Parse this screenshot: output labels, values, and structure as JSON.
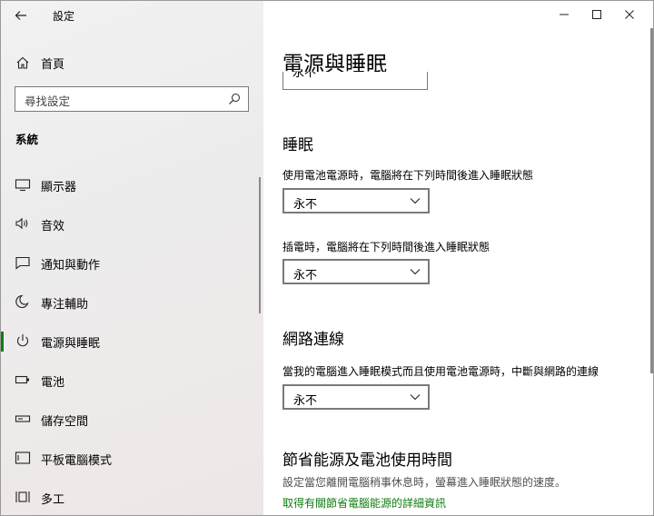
{
  "window": {
    "title": "設定",
    "minimize_icon": "minimize-icon",
    "maximize_icon": "maximize-icon",
    "close_icon": "close-icon"
  },
  "sidebar": {
    "home_label": "首頁",
    "search_placeholder": "尋找設定",
    "section_label": "系統",
    "items": [
      {
        "label": "顯示器",
        "icon": "monitor-icon"
      },
      {
        "label": "音效",
        "icon": "speaker-icon"
      },
      {
        "label": "通知與動作",
        "icon": "notification-icon"
      },
      {
        "label": "專注輔助",
        "icon": "moon-icon"
      },
      {
        "label": "電源與睡眠",
        "icon": "power-icon",
        "selected": true
      },
      {
        "label": "電池",
        "icon": "battery-icon"
      },
      {
        "label": "儲存空間",
        "icon": "storage-icon"
      },
      {
        "label": "平板電腦模式",
        "icon": "tablet-icon"
      },
      {
        "label": "多工",
        "icon": "multitask-icon"
      }
    ]
  },
  "main": {
    "page_title": "電源與睡眠",
    "cut_dropdown_value": "永不",
    "sleep": {
      "heading": "睡眠",
      "battery_label": "使用電池電源時，電腦將在下列時間後進入睡眠狀態",
      "battery_value": "永不",
      "plugged_label": "插電時，電腦將在下列時間後進入睡眠狀態",
      "plugged_value": "永不"
    },
    "network": {
      "heading": "網路連線",
      "label": "當我的電腦進入睡眠模式而且使用電池電源時，中斷與網路的連線",
      "value": "永不"
    },
    "battery_saving": {
      "heading": "節省能源及電池使用時間",
      "description": "設定當您離開電腦稍事休息時，螢幕進入睡眠狀態的速度。",
      "link": "取得有關節省電腦能源的詳細資訊"
    }
  },
  "colors": {
    "accent": "#107c10",
    "sidebar_bg": "#eeeeee"
  }
}
